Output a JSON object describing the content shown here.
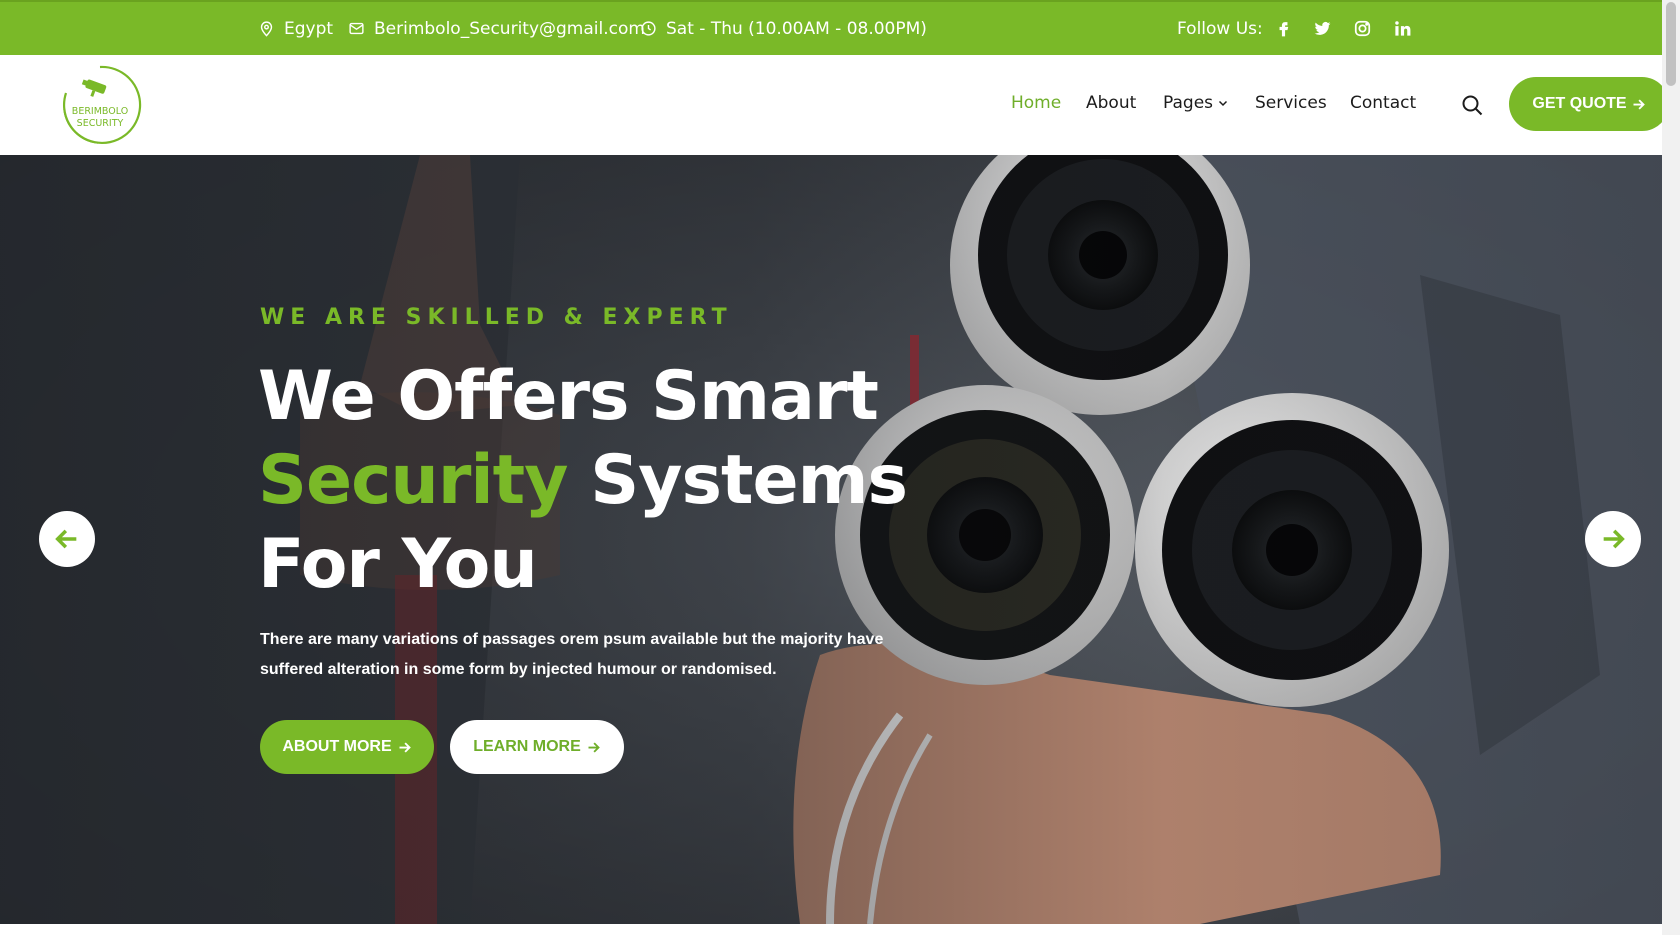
{
  "topbar": {
    "location": "Egypt",
    "email": "Berimbolo_Security@gmail.com",
    "hours": "Sat - Thu (10.00AM - 08.00PM)",
    "follow_label": "Follow Us:",
    "icons": [
      "location-icon",
      "mail-icon",
      "clock-icon",
      "facebook-icon",
      "twitter-icon",
      "instagram-icon",
      "linkedin-icon"
    ]
  },
  "header": {
    "logo": {
      "line1": "BERIMBOLO",
      "line2": "SECURITY"
    },
    "nav": [
      {
        "label": "Home",
        "active": true
      },
      {
        "label": "About"
      },
      {
        "label": "Pages"
      },
      {
        "label": "Services"
      },
      {
        "label": "Contact"
      }
    ],
    "quote_label": "GET QUOTE"
  },
  "hero": {
    "eyebrow": "WE ARE SKILLED & EXPERT",
    "headline_line1": "We Offers Smart",
    "headline_accent": "Security",
    "headline_line2_rest": "Systems",
    "headline_line3": "For You",
    "description": "There are many variations of passages orem psum available but the majority have suffered alteration in some form by injected humour or randomised.",
    "about_label": "ABOUT MORE",
    "learn_label": "LEARN MORE"
  },
  "colors": {
    "accent": "#7ab928",
    "text_dark": "#1c1c1c",
    "white": "#ffffff"
  }
}
